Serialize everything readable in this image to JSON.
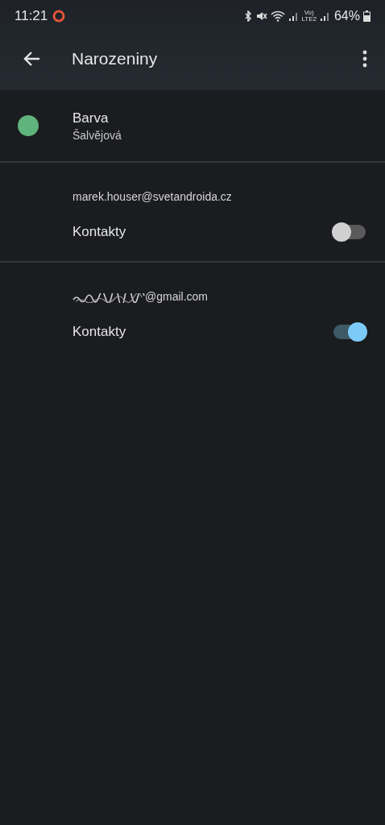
{
  "status_bar": {
    "time": "11:21",
    "network_badge": [
      "Vo)",
      "LTE2"
    ],
    "battery": "64%"
  },
  "app_bar": {
    "title": "Narozeniny"
  },
  "color_setting": {
    "label": "Barva",
    "value": "Šalvějová",
    "color": "#5fb37c"
  },
  "accounts": [
    {
      "email": "marek.houser@svetandroida.cz",
      "redacted": false,
      "items": [
        {
          "label": "Kontakty",
          "on": false
        }
      ]
    },
    {
      "email": "@gmail.com",
      "redacted": true,
      "items": [
        {
          "label": "Kontakty",
          "on": true
        }
      ]
    }
  ]
}
